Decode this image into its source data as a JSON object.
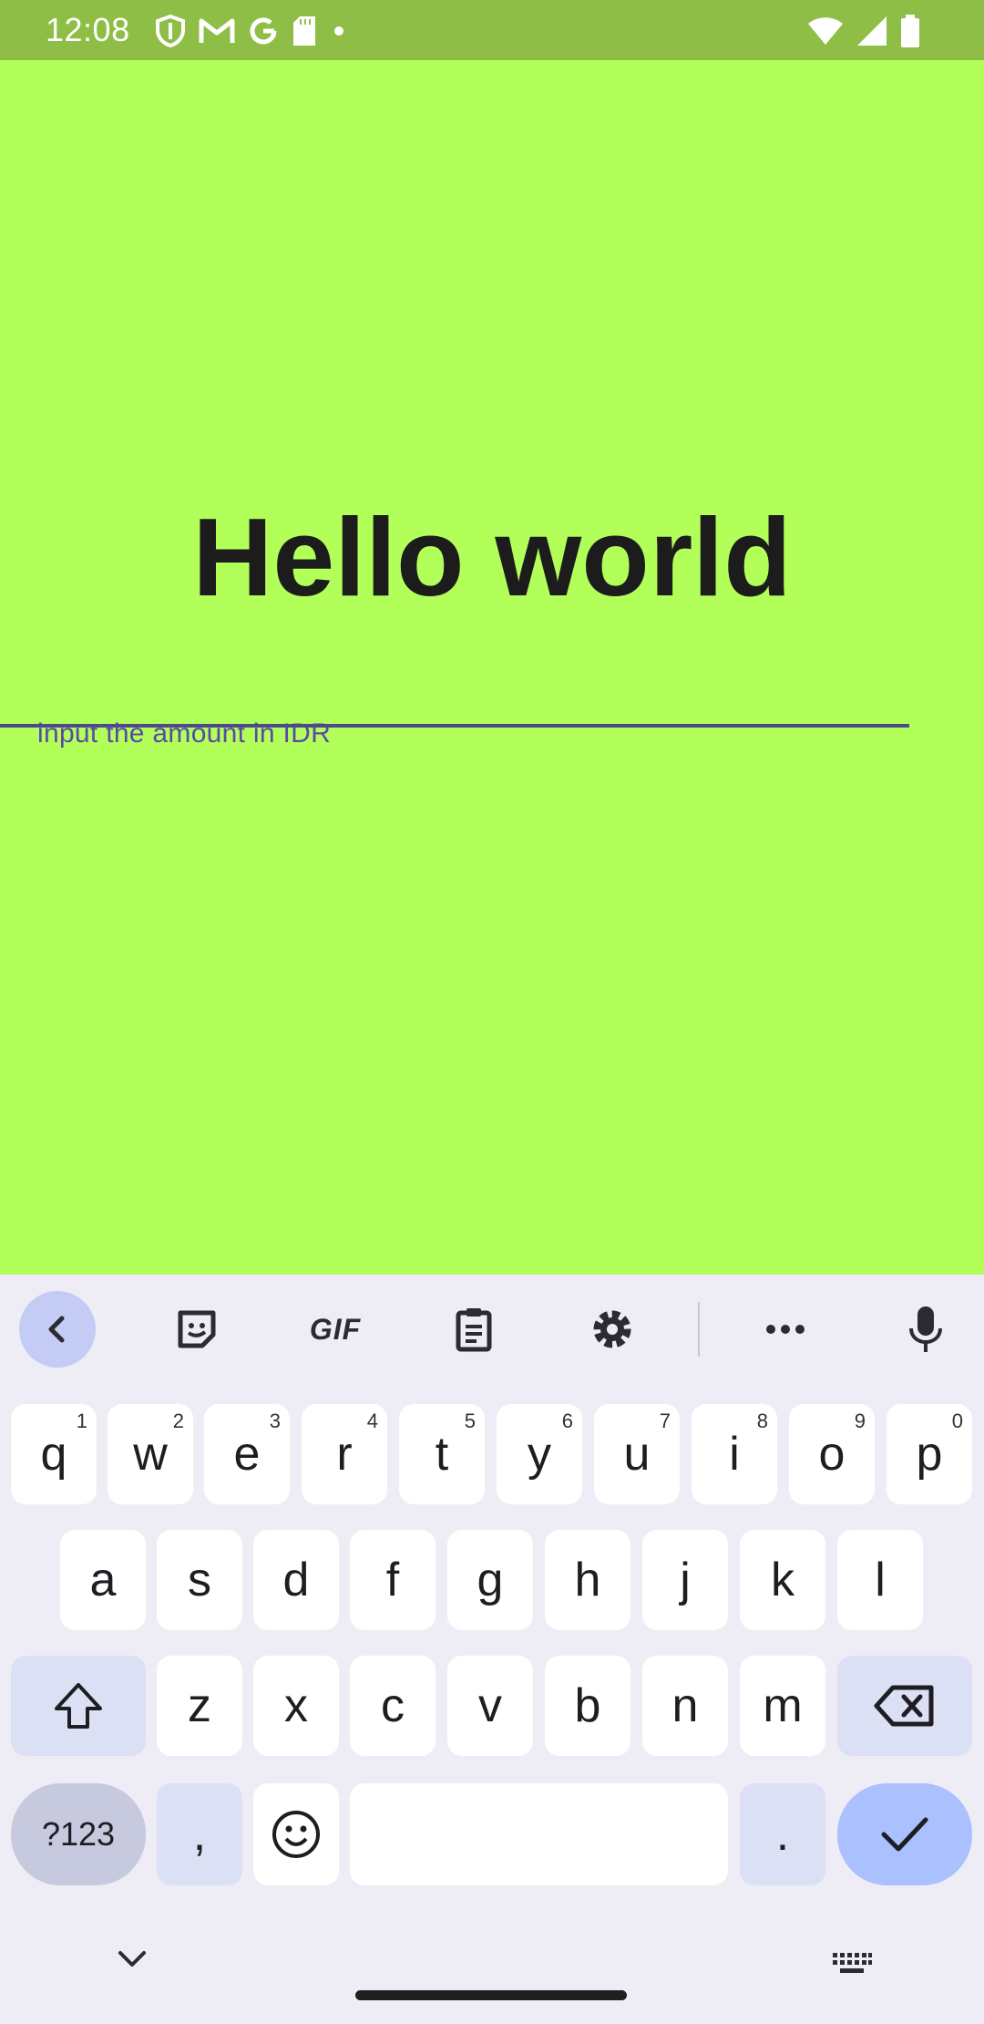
{
  "status_bar": {
    "time": "12:08",
    "left_icons": [
      "shield-icon",
      "gmail-icon",
      "google-icon",
      "sd-card-icon",
      "dot-icon"
    ],
    "right_icons": [
      "wifi-icon",
      "signal-icon",
      "battery-icon"
    ],
    "background": "#8fbe46"
  },
  "app": {
    "background": "#b3ff5a",
    "title": "Hello world",
    "amount_field": {
      "placeholder": "input the amount in IDR",
      "value": "",
      "accent_color": "#4d4a8a"
    }
  },
  "keyboard": {
    "toolbar": [
      "back-icon",
      "sticker-icon",
      "gif-icon",
      "clipboard-icon",
      "settings-icon",
      "more-icon",
      "microphone-icon"
    ],
    "gif_label": "GIF",
    "row1": [
      {
        "key": "q",
        "hint": "1"
      },
      {
        "key": "w",
        "hint": "2"
      },
      {
        "key": "e",
        "hint": "3"
      },
      {
        "key": "r",
        "hint": "4"
      },
      {
        "key": "t",
        "hint": "5"
      },
      {
        "key": "y",
        "hint": "6"
      },
      {
        "key": "u",
        "hint": "7"
      },
      {
        "key": "i",
        "hint": "8"
      },
      {
        "key": "o",
        "hint": "9"
      },
      {
        "key": "p",
        "hint": "0"
      }
    ],
    "row2": [
      "a",
      "s",
      "d",
      "f",
      "g",
      "h",
      "j",
      "k",
      "l"
    ],
    "row3": [
      "z",
      "x",
      "c",
      "v",
      "b",
      "n",
      "m"
    ],
    "symbols_label": "?123",
    "comma": ",",
    "period": ".",
    "accent_color": "#aac0ff"
  },
  "nav_bar": {
    "left_icon": "chevron-down-icon",
    "right_icon": "keyboard-icon"
  }
}
